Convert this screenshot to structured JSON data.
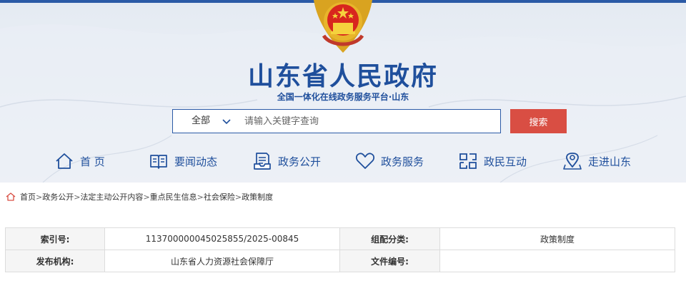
{
  "header": {
    "title": "山东省人民政府",
    "subtitle": "全国一体化在线政务服务平台·山东",
    "colors": {
      "brand_blue": "#1f4f9c",
      "search_red": "#d94e43"
    }
  },
  "search": {
    "scope": "全部",
    "placeholder": "请输入关键字查询",
    "value": "",
    "button_label": "搜索"
  },
  "nav": [
    {
      "label": "首 页",
      "icon": "home-icon"
    },
    {
      "label": "要闻动态",
      "icon": "book-icon"
    },
    {
      "label": "政务公开",
      "icon": "document-icon"
    },
    {
      "label": "政务服务",
      "icon": "heart-icon"
    },
    {
      "label": "政民互动",
      "icon": "interaction-icon"
    },
    {
      "label": "走进山东",
      "icon": "location-icon"
    }
  ],
  "breadcrumb": [
    "首页",
    "政务公开",
    "法定主动公开内容",
    "重点民生信息",
    "社会保险",
    "政策制度"
  ],
  "info_table": {
    "rows": [
      {
        "k1": "索引号:",
        "v1": "113700000045025855/2025-00845",
        "k2": "组配分类:",
        "v2": "政策制度"
      },
      {
        "k1": "发布机构:",
        "v1": "山东省人力资源社会保障厅",
        "k2": "文件编号:",
        "v2": ""
      }
    ]
  }
}
